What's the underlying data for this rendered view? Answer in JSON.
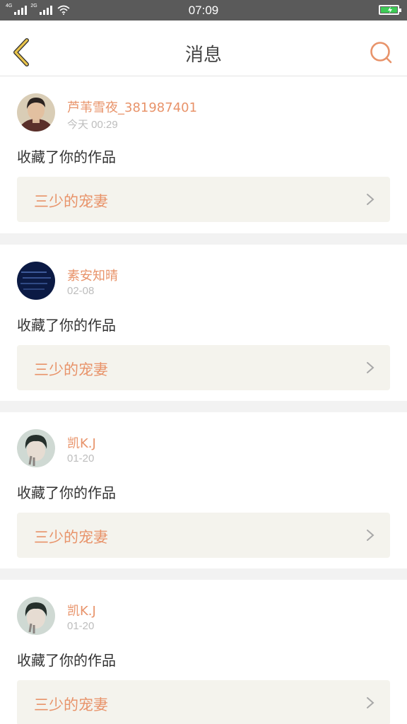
{
  "status_bar": {
    "time": "07:09",
    "network_1": "4G",
    "network_2": "2G"
  },
  "header": {
    "title": "消息",
    "back_icon": "chevron-left-icon",
    "search_icon": "search-icon"
  },
  "colors": {
    "accent": "#e8936a",
    "back_arrow": "#e8c34a",
    "card_bg": "#f4f3ed",
    "battery": "#3ecb56"
  },
  "messages": [
    {
      "username": "芦苇雪夜_381987401",
      "time": "今天 00:29",
      "action": "收藏了你的作品",
      "work_title": "三少的宠妻"
    },
    {
      "username": "素安知晴",
      "time": "02-08",
      "action": "收藏了你的作品",
      "work_title": "三少的宠妻"
    },
    {
      "username": "凯K.J",
      "time": "01-20",
      "action": "收藏了你的作品",
      "work_title": "三少的宠妻"
    },
    {
      "username": "凯K.J",
      "time": "01-20",
      "action": "收藏了你的作品",
      "work_title": "三少的宠妻"
    }
  ]
}
